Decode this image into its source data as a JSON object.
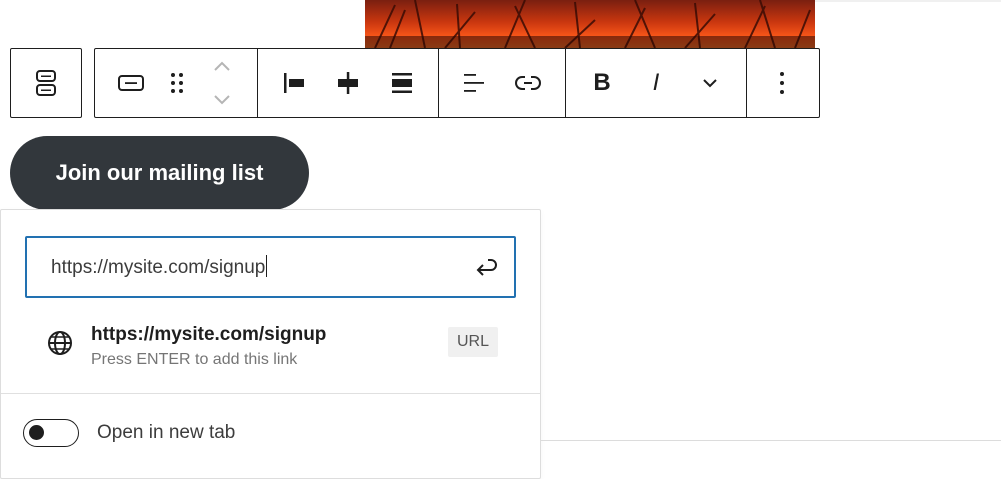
{
  "colors": {
    "button_bg": "#32373c",
    "focus_border": "#2271b1",
    "toolbar_border": "#1e1e1e"
  },
  "cover_image": {
    "icon": "grass-sunset-image"
  },
  "toolbar": {
    "parent_block_icon": "buttons-block-icon",
    "block_type_icon": "button-block-icon",
    "drag_icon": "drag-handle-icon",
    "move_up_icon": "chevron-up-icon",
    "move_down_icon": "chevron-down-icon",
    "justify_left_icon": "justify-left-icon",
    "justify_center_icon": "justify-center-icon",
    "justify_stretch_icon": "justify-stretch-icon",
    "text_align_icon": "align-left-icon",
    "link_icon": "link-icon",
    "bold_label": "B",
    "italic_label": "I",
    "more_formats_icon": "chevron-down-icon",
    "options_icon": "more-vertical-icon"
  },
  "button_block": {
    "text": "Join our mailing list"
  },
  "link_popover": {
    "input_value": "https://mysite.com/signup",
    "submit_icon": "enter-icon",
    "suggestion": {
      "icon": "globe-icon",
      "title": "https://mysite.com/signup",
      "info": "Press ENTER to add this link",
      "badge": "URL"
    },
    "new_tab_label": "Open in new tab",
    "new_tab_enabled": false
  }
}
